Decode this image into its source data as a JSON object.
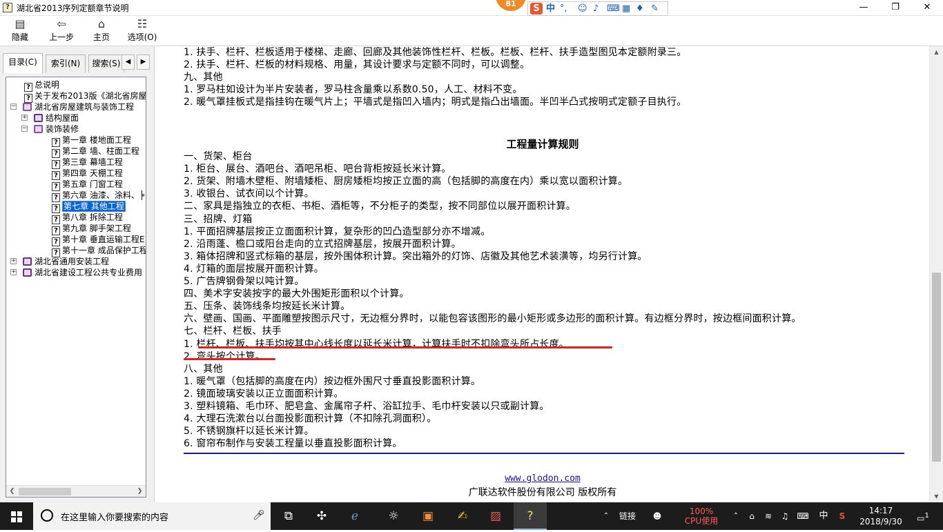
{
  "window": {
    "title": "湖北省2013序列定额章节说明",
    "icon_glyph": "?",
    "minimize_glyph": "—",
    "maximize_glyph": "❐",
    "close_glyph": "✕"
  },
  "ime": {
    "badge": "81",
    "logo": "S",
    "lang": "中",
    "punct": "°,"
  },
  "toolbar": [
    {
      "label": "隐藏",
      "icon": "hide-icon",
      "glyph": "▤"
    },
    {
      "label": "上一步",
      "icon": "back-arrow-icon",
      "glyph": "⇦"
    },
    {
      "label": "主页",
      "icon": "home-icon",
      "glyph": "⌂"
    },
    {
      "label": "选项(O)",
      "icon": "options-icon",
      "glyph": "☷"
    }
  ],
  "left_tabs": [
    {
      "label": "目录(C)",
      "active": true
    },
    {
      "label": "索引(N)",
      "active": false
    },
    {
      "label": "搜索(S)",
      "active": false
    }
  ],
  "tree": [
    {
      "label": "总说明",
      "level": 2,
      "type": "page"
    },
    {
      "label": "关于发布2013版《湖北省房屋",
      "level": 2,
      "type": "page"
    },
    {
      "label": "湖北省房屋建筑与装饰工程",
      "level": 0,
      "type": "book-open",
      "expander": "−"
    },
    {
      "label": "结构屋面",
      "level": 1,
      "type": "book",
      "expander": "+"
    },
    {
      "label": "装饰装修",
      "level": 1,
      "type": "book-open",
      "expander": "−"
    },
    {
      "label": "第一章 楼地面工程",
      "level": 3,
      "type": "page"
    },
    {
      "label": "第二章 墙、柱面工程",
      "level": 3,
      "type": "page"
    },
    {
      "label": "第三章 幕墙工程",
      "level": 3,
      "type": "page"
    },
    {
      "label": "第四章 天棚工程",
      "level": 3,
      "type": "page"
    },
    {
      "label": "第五章 门窗工程",
      "level": 3,
      "type": "page"
    },
    {
      "label": "第六章 油漆、涂料、╞",
      "level": 3,
      "type": "page"
    },
    {
      "label": "第七章 其他工程",
      "level": 3,
      "type": "page",
      "selected": true
    },
    {
      "label": "第八章 拆除工程",
      "level": 3,
      "type": "page"
    },
    {
      "label": "第九章 脚手架工程",
      "level": 3,
      "type": "page"
    },
    {
      "label": "第十章 垂直运输工程E",
      "level": 3,
      "type": "page"
    },
    {
      "label": "第十一章 成品保护工程",
      "level": 3,
      "type": "page"
    },
    {
      "label": "湖北省通用安装工程",
      "level": 0,
      "type": "book",
      "expander": "+"
    },
    {
      "label": "湖北省建设工程公共专业费用",
      "level": 0,
      "type": "book",
      "expander": "+"
    }
  ],
  "content": {
    "top_lines": [
      "1. 扶手、栏杆、栏板适用于楼梯、走廊、回廊及其他装饰性栏杆、栏板。栏板、栏杆、扶手造型图见本定额附录三。",
      "2. 扶手、栏杆、栏板的材料规格、用量，其设计要求与定额不同时，可以调整。",
      "九、其他",
      "1. 罗马柱如设计为半片安装者，罗马柱含量乘以系数0.50，人工、材料不变。",
      "2. 暖气罩挂板式是指挂钩在暖气片上；平墙式是指凹入墙内；明式是指凸出墙面。半凹半凸式按明式定额子目执行。"
    ],
    "heading": "工程量计算规则",
    "rule_lines": [
      "一、货架、柜台",
      "1. 柜台、展台、酒吧台、酒吧吊柜、吧台背柜按延长米计算。",
      "2. 货架、附墙木壁柜、附墙矮柜、厨房矮柜均按正立面的高（包括脚的高度在内）乘以宽以面积计算。",
      "3. 收银台、试衣间以个计算。",
      "二、家具是指独立的衣柜、书柜、酒柜等，不分柜子的类型，按不同部位以展开面积计算。",
      "三、招牌、灯箱",
      "1. 平面招牌基层按正立面面积计算，复杂形的凹凸造型部分亦不增减。",
      "2. 沿雨蓬、檐口或阳台走向的立式招牌基层，按展开面积计算。",
      "3. 箱体招牌和竖式标箱的基层，按外围体积计算。突出箱外的灯饰、店徽及其他艺术装潢等，均另行计算。",
      "4. 灯箱的面层按展开面积计算。",
      "5. 广告牌钢骨架以吨计算。",
      "四、美术字安装按字的最大外围矩形面积以个计算。",
      "五、压条、装饰线条均按延长米计算。",
      "六、壁画、国画、平面雕塑按图示尺寸，无边框分界时，以能包容该图形的最小矩形或多边形的面积计算。有边框分界时，按边框间面积计算。",
      "七、栏杆、栏板、扶手",
      "1. 栏杆、栏板、扶手均按其中心线长度以延长米计算，计算扶手时不扣除弯头所占长度。",
      "2. 弯头按个计算。",
      "八、其他",
      "1. 暖气罩（包括脚的高度在内）按边框外围尺寸垂直投影面积计算。",
      "2. 镜面玻璃安装以正立面面积计算。",
      "3. 塑料镜箱、毛巾环、肥皂盒、金属帘子杆、浴缸拉手、毛巾杆安装以只或副计算。",
      "4. 大理石洗漱台以台面投影面积计算（不扣除孔洞面积）。",
      "5. 不锈钢旗杆以延长米计算。",
      "6. 窗帘布制作与安装工程量以垂直投影面积计算。"
    ],
    "underline_color": "#e02020",
    "footer_link": "www.glodon.com",
    "footer_copyright": "广联达软件股份有限公司 版权所有"
  },
  "taskbar": {
    "search_placeholder": "在这里输入你要搜索的内容",
    "apps": [
      "task-view-icon",
      "pinwheel-icon",
      "ie-icon",
      "settings-spiral-icon",
      "pdf-icon",
      "notes-icon",
      "paint-icon",
      "help-file-icon"
    ],
    "links_label": "链接",
    "cpu_percent": "100%",
    "cpu_label": "CPU使用",
    "lang": "中",
    "time": "14:17",
    "date": "2018/9/30",
    "notification_count": "1"
  }
}
